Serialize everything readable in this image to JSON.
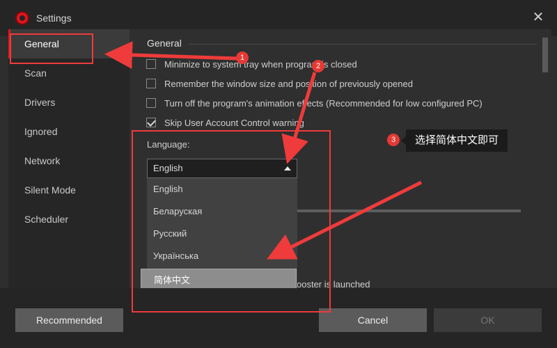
{
  "window": {
    "title": "Settings"
  },
  "sidebar": {
    "items": [
      {
        "label": "General"
      },
      {
        "label": "Scan"
      },
      {
        "label": "Drivers"
      },
      {
        "label": "Ignored"
      },
      {
        "label": "Network"
      },
      {
        "label": "Silent Mode"
      },
      {
        "label": "Scheduler"
      }
    ]
  },
  "general": {
    "title": "General",
    "options": [
      {
        "label": "Minimize to system tray when program is closed",
        "checked": false
      },
      {
        "label": "Remember the window size and position of previously opened",
        "checked": false
      },
      {
        "label": "Turn off the program's animation effects (Recommended for low configured PC)",
        "checked": false
      },
      {
        "label": "Skip User Account Control warning",
        "checked": true
      }
    ],
    "language": {
      "label": "Language:",
      "selected": "English",
      "options": [
        "English",
        "Беларуская",
        "Русский",
        "Українська",
        "简体中文"
      ],
      "highlighted": "简体中文"
    },
    "partial_text": "ooster is launched"
  },
  "footer": {
    "recommended": "Recommended",
    "cancel": "Cancel",
    "ok": "OK"
  },
  "annotations": {
    "markers": [
      "1",
      "2",
      "3"
    ],
    "tooltip": "选择简体中文即可",
    "color": "#ef3b3b"
  }
}
